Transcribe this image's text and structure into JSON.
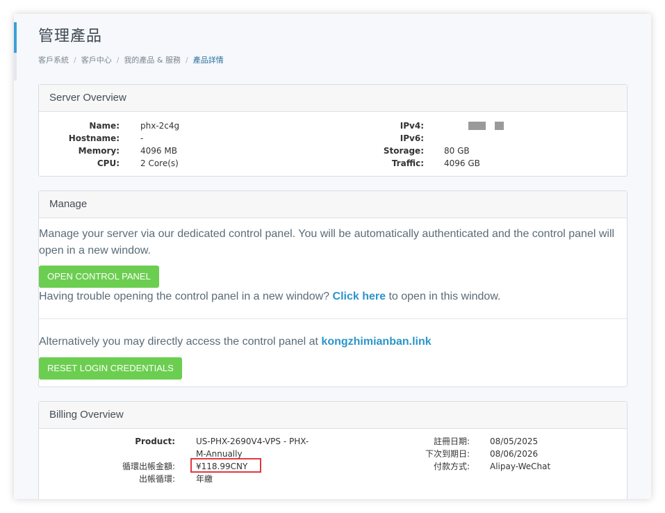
{
  "page": {
    "title": "管理產品",
    "breadcrumb": [
      "客戶系統",
      "客戶中心",
      "我的產品 & 服務",
      "產品詳情"
    ]
  },
  "server_overview": {
    "heading": "Server Overview",
    "left": [
      {
        "label": "Name:",
        "value": "phx-2c4g"
      },
      {
        "label": "Hostname:",
        "value": "-"
      },
      {
        "label": "Memory:",
        "value": "4096 MB"
      },
      {
        "label": "CPU:",
        "value": "2 Core(s)"
      }
    ],
    "right": [
      {
        "label": "IPv4:",
        "value": ""
      },
      {
        "label": "IPv6:",
        "value": ""
      },
      {
        "label": "Storage:",
        "value": "80 GB"
      },
      {
        "label": "Traffic:",
        "value": "4096 GB"
      }
    ]
  },
  "manage": {
    "heading": "Manage",
    "intro": "Manage your server via our dedicated control panel. You will be automatically authenticated and the control panel will open in a new window.",
    "open_button": "OPEN CONTROL PANEL",
    "trouble_prefix": "Having trouble opening the control panel in a new window?",
    "trouble_link": "Click here",
    "trouble_suffix": "to open in this window.",
    "alt_prefix": "Alternatively you may directly access the control panel at",
    "alt_link": "kongzhimianban.link",
    "reset_button": "RESET LOGIN CREDENTIALS"
  },
  "billing": {
    "heading": "Billing Overview",
    "product_label": "Product:",
    "product_line1": "US-PHX-2690V4-VPS - PHX-",
    "product_line2": "M-Annually",
    "amount_label": "循環出帳金額:",
    "amount_value": "¥118.99CNY",
    "cycle_label": "出帳循環:",
    "cycle_value": "年繳",
    "reg_label": "註冊日期:",
    "reg_value": "08/05/2025",
    "due_label": "下次到期日:",
    "due_value": "08/06/2026",
    "pay_label": "付款方式:",
    "pay_value": "Alipay-WeChat"
  },
  "colors": {
    "accent": "#3ba0d8",
    "button_green": "#6cce50",
    "link_blue": "#2b95c9",
    "highlight_red": "#e0393e"
  }
}
